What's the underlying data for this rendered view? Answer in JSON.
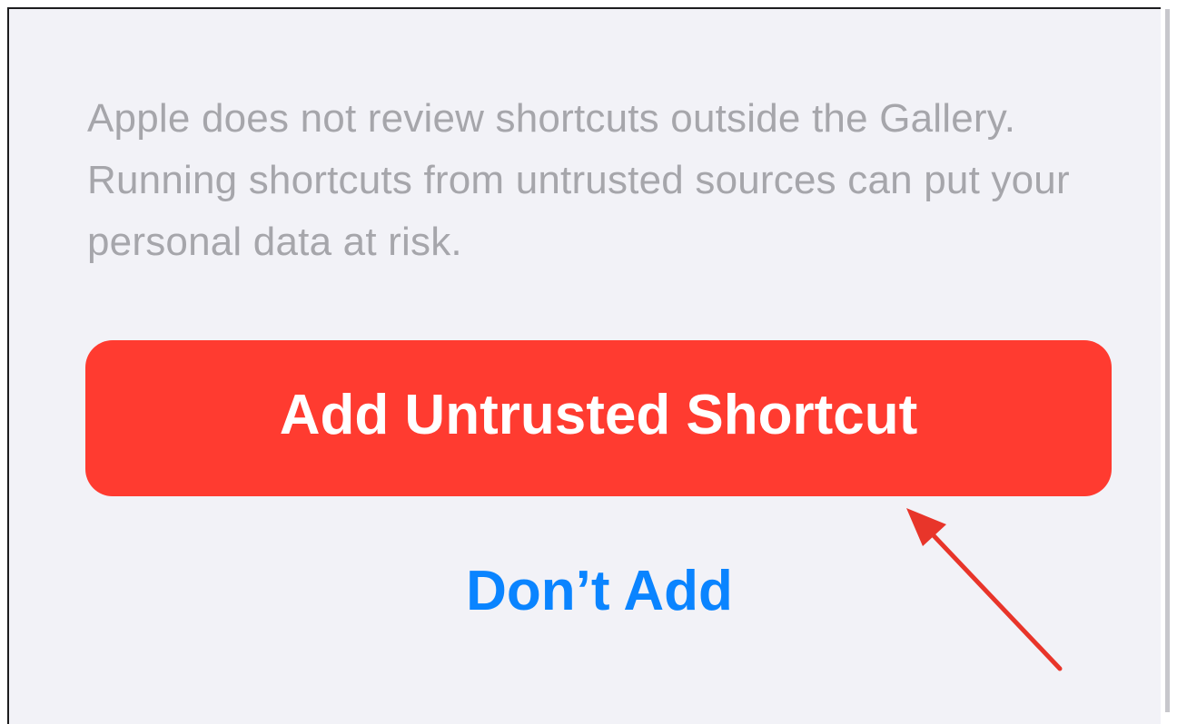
{
  "dialog": {
    "warning_text": "Apple does not review shortcuts outside the Gallery. Running shortcuts from untrusted sources can put your personal data at risk.",
    "primary_button_label": "Add Untrusted Shortcut",
    "secondary_button_label": "Don’t Add"
  },
  "colors": {
    "background": "#f2f2f7",
    "warning_text": "#a6a6ab",
    "destructive": "#ff3b30",
    "link_blue": "#0a84ff",
    "annotation_arrow": "#e8352a"
  },
  "annotation": {
    "type": "arrow",
    "points_to": "add-untrusted-shortcut-button"
  }
}
